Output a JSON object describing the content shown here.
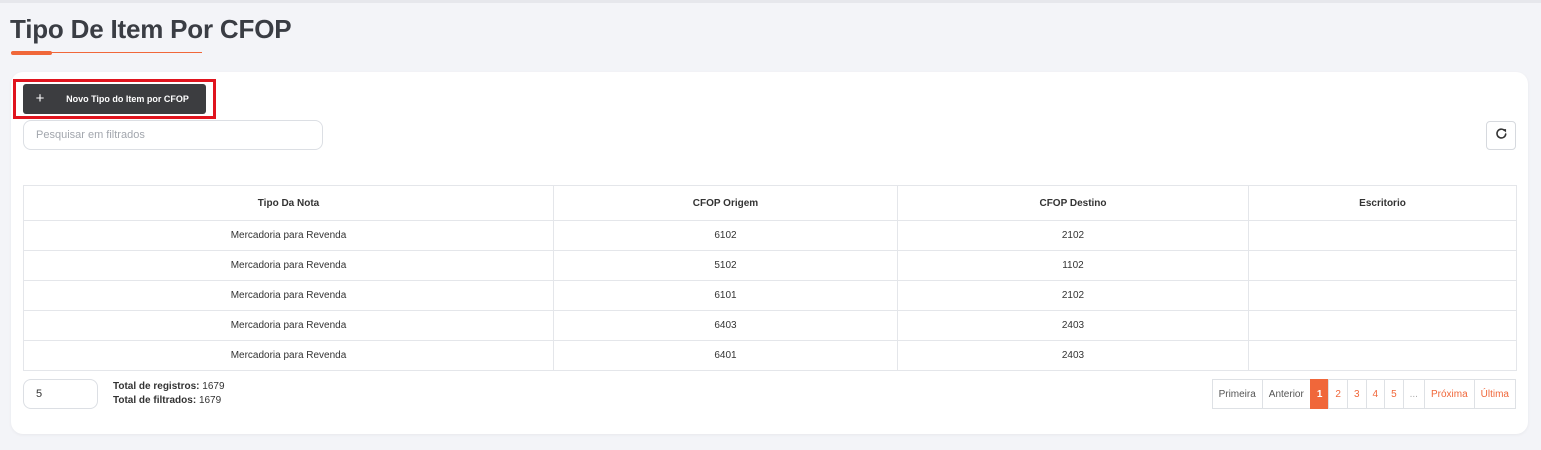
{
  "page": {
    "title": "Tipo De Item Por CFOP"
  },
  "toolbar": {
    "new_button_icon": "+",
    "new_button_label": "Novo Tipo do Item por CFOP",
    "search_placeholder": "Pesquisar em filtrados",
    "search_value": "",
    "refresh_icon": "refresh-icon"
  },
  "table": {
    "columns": [
      "Tipo Da Nota",
      "CFOP Origem",
      "CFOP Destino",
      "Escritorio"
    ],
    "rows": [
      [
        "Mercadoria para Revenda",
        "6102",
        "2102",
        ""
      ],
      [
        "Mercadoria para Revenda",
        "5102",
        "1102",
        ""
      ],
      [
        "Mercadoria para Revenda",
        "6101",
        "2102",
        ""
      ],
      [
        "Mercadoria para Revenda",
        "6403",
        "2403",
        ""
      ],
      [
        "Mercadoria para Revenda",
        "6401",
        "2403",
        ""
      ]
    ]
  },
  "footer": {
    "page_size": "5",
    "total_records_label": "Total de registros:",
    "total_records_value": "1679",
    "total_filtered_label": "Total de filtrados:",
    "total_filtered_value": "1679"
  },
  "pagination": {
    "first": "Primeira",
    "previous": "Anterior",
    "pages": [
      "1",
      "2",
      "3",
      "4",
      "5"
    ],
    "current": "1",
    "ellipsis": "...",
    "next": "Próxima",
    "last": "Última"
  },
  "colors": {
    "accent": "#f0673a",
    "button_dark": "#3c3d40",
    "highlight_frame": "#e0141e"
  }
}
